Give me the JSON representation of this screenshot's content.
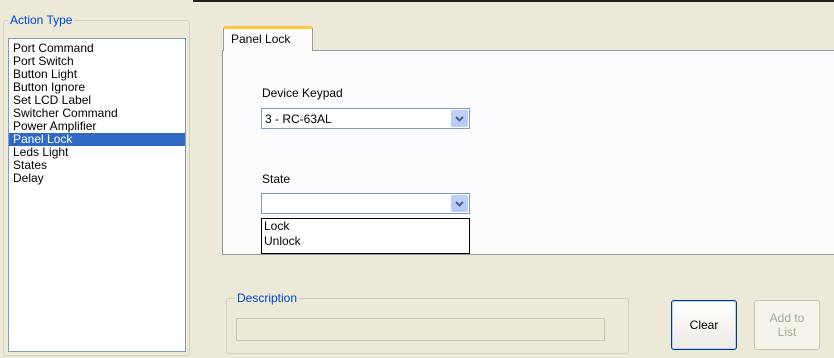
{
  "action_type": {
    "legend": "Action Type",
    "items": [
      {
        "label": "Port Command"
      },
      {
        "label": "Port Switch"
      },
      {
        "label": "Button Light"
      },
      {
        "label": "Button Ignore"
      },
      {
        "label": "Set LCD Label"
      },
      {
        "label": "Switcher Command"
      },
      {
        "label": "Power Amplifier"
      },
      {
        "label": "Panel Lock",
        "selected": true
      },
      {
        "label": "Leds Light"
      },
      {
        "label": "States"
      },
      {
        "label": "Delay"
      }
    ]
  },
  "tab": {
    "label": "Panel Lock"
  },
  "device_keypad": {
    "label": "Device Keypad",
    "value": "3 - RC-63AL"
  },
  "state": {
    "label": "State",
    "value": "",
    "options": [
      "Lock",
      "Unlock"
    ]
  },
  "description": {
    "legend": "Description",
    "value": ""
  },
  "buttons": {
    "clear": "Clear",
    "add_to_list": "Add to List"
  },
  "icons": {
    "dropdown_arrow": "chevron-down-icon"
  },
  "colors": {
    "window_bg": "#ece9d8",
    "selection": "#316ac5",
    "legend_text": "#0046d5",
    "tab_accent": "#ffc83c"
  }
}
